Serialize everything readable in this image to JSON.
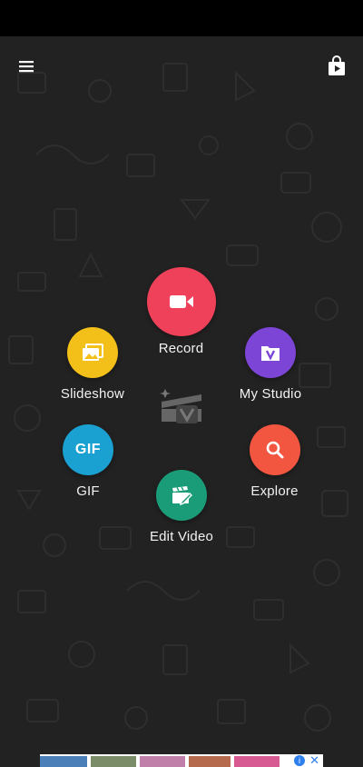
{
  "colors": {
    "background": "#222222",
    "record": "#f0415a",
    "slideshow": "#f2c018",
    "my_studio": "#7d45d6",
    "gif": "#1aa0d1",
    "explore": "#f25540",
    "edit_video": "#1b9c78"
  },
  "header": {
    "menu_icon": "hamburger-menu-icon",
    "store_icon": "shopping-bag-play-icon"
  },
  "actions": {
    "record": {
      "label": "Record",
      "icon": "video-camera-icon"
    },
    "slideshow": {
      "label": "Slideshow",
      "icon": "photos-stack-icon"
    },
    "my_studio": {
      "label": "My Studio",
      "icon": "folder-v-icon"
    },
    "gif": {
      "label": "GIF",
      "icon": "gif-text-icon"
    },
    "explore": {
      "label": "Explore",
      "icon": "magnifier-icon"
    },
    "edit_video": {
      "label": "Edit Video",
      "icon": "clapperboard-pencil-icon"
    }
  },
  "center_logo": {
    "icon": "vivavideo-clapper-logo"
  },
  "ad": {
    "info_icon": "ad-choices-icon",
    "close_icon": "close-icon"
  }
}
